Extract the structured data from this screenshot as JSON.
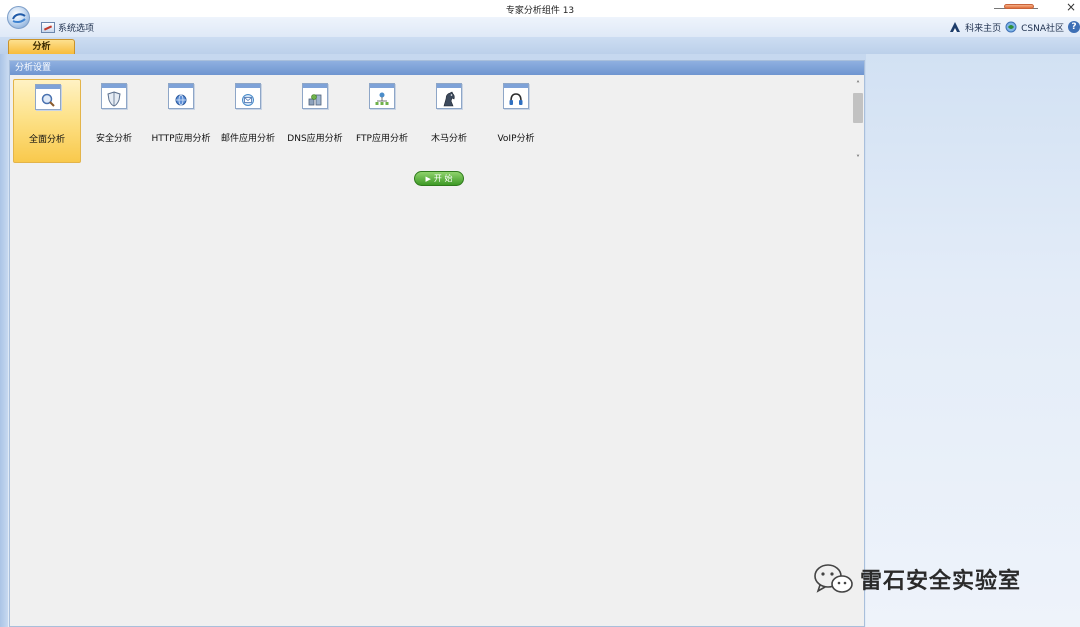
{
  "window": {
    "title": "专家分析组件 13",
    "close_glyph": "×"
  },
  "menubar": {
    "system_options": "系统选项",
    "links": [
      {
        "label": "科来主页",
        "icon": "colasoft-logo-icon"
      },
      {
        "label": "CSNA社区",
        "icon": "community-icon"
      }
    ],
    "help_glyph": "?"
  },
  "ribbon": {
    "tabs": [
      {
        "label": "分析",
        "active": true
      }
    ]
  },
  "panel": {
    "title": "分析设置",
    "tools": [
      {
        "label": "全面分析",
        "icon": "magnifier-icon",
        "selected": true
      },
      {
        "label": "安全分析",
        "icon": "shield-icon",
        "selected": false
      },
      {
        "label": "HTTP应用分析",
        "icon": "web-icon",
        "selected": false
      },
      {
        "label": "邮件应用分析",
        "icon": "mail-icon",
        "selected": false
      },
      {
        "label": "DNS应用分析",
        "icon": "dns-icon",
        "selected": false
      },
      {
        "label": "FTP应用分析",
        "icon": "ftp-icon",
        "selected": false
      },
      {
        "label": "木马分析",
        "icon": "trojan-horse-icon",
        "selected": false
      },
      {
        "label": "VoIP分析",
        "icon": "headset-icon",
        "selected": false
      }
    ],
    "start_button": "开 始",
    "scroll_up_glyph": "˄",
    "scroll_down_glyph": "˅"
  },
  "watermark": {
    "text": "雷石安全实验室"
  },
  "colors": {
    "accent_selected": "#f9c94c",
    "panel_header": "#7ea2d8",
    "start_button": "#3e9a26"
  }
}
